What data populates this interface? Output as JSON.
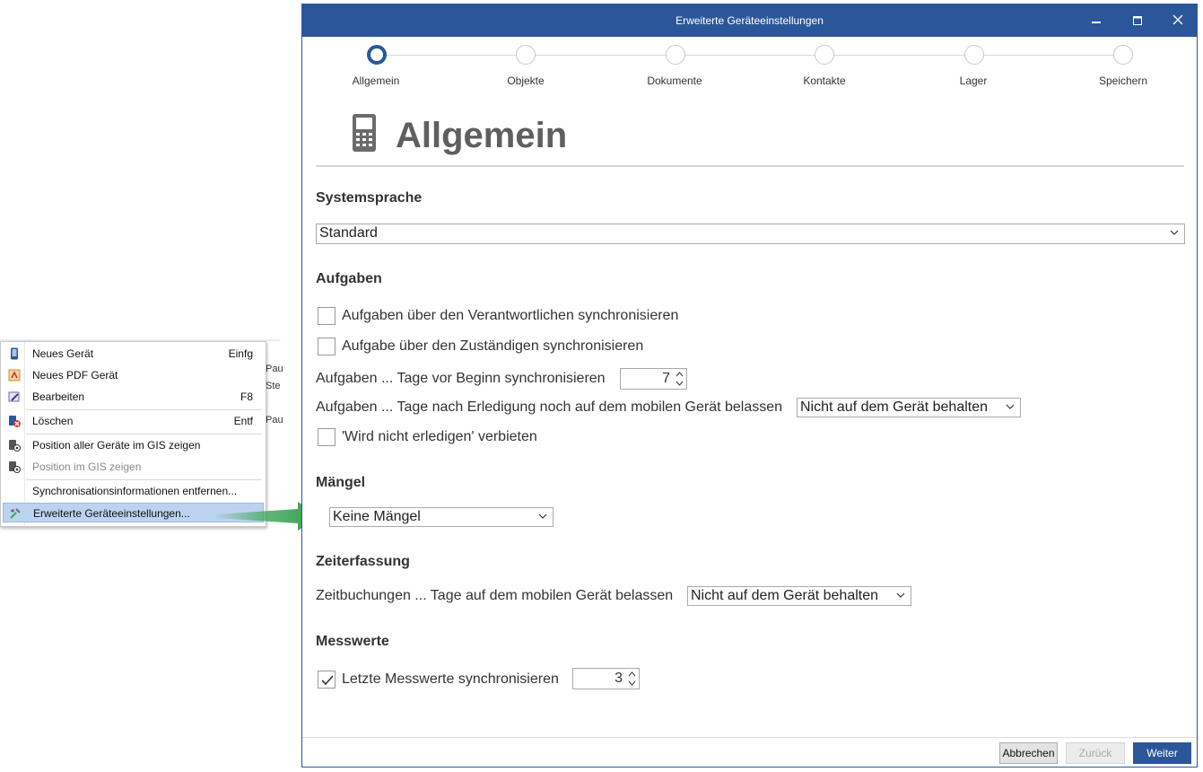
{
  "context_menu": {
    "items": [
      {
        "label": "Neues Gerät",
        "shortcut": "Einfg",
        "icon": "phone-icon"
      },
      {
        "label": "Neues PDF Gerät",
        "shortcut": "",
        "icon": "pdf-icon"
      },
      {
        "label": "Bearbeiten",
        "shortcut": "F8",
        "icon": "edit-icon"
      },
      {
        "label": "Löschen",
        "shortcut": "Entf",
        "icon": "delete-icon"
      },
      {
        "label": "Position aller Geräte im GIS zeigen",
        "shortcut": "",
        "icon": "gis-all-icon"
      },
      {
        "label": "Position im GIS zeigen",
        "shortcut": "",
        "icon": "gis-icon"
      },
      {
        "label": "Synchronisationsinformationen entfernen...",
        "shortcut": "",
        "icon": ""
      },
      {
        "label": "Erweiterte Geräteeinstellungen...",
        "shortcut": "",
        "icon": "tools-icon"
      }
    ]
  },
  "background_table": {
    "rows": [
      "Pau",
      "Ste",
      "Pau"
    ]
  },
  "dialog": {
    "title": "Erweiterte Geräteeinstellungen",
    "window_buttons": {
      "minimize": "▬",
      "maximize": "☐",
      "close": "✕"
    },
    "steps": [
      "Allgemein",
      "Objekte",
      "Dokumente",
      "Kontakte",
      "Lager",
      "Speichern"
    ],
    "active_step": 0,
    "page_title": "Allgemein",
    "systemsprache": {
      "heading": "Systemsprache",
      "value": "Standard"
    },
    "aufgaben": {
      "heading": "Aufgaben",
      "chk_verantwortlich": "Aufgaben über den Verantwortlichen synchronisieren",
      "chk_zustaendig": "Aufgabe über den Zuständigen synchronisieren",
      "tage_vor_label": "Aufgaben ... Tage vor Beginn synchronisieren",
      "tage_vor_value": "7",
      "tage_nach_label": "Aufgaben ... Tage nach Erledigung noch auf dem mobilen Gerät belassen",
      "tage_nach_value": "Nicht auf dem Gerät behalten",
      "chk_nicht_erledigen": "'Wird nicht erledigen' verbieten"
    },
    "maengel": {
      "heading": "Mängel",
      "value": "Keine Mängel"
    },
    "zeiterfassung": {
      "heading": "Zeiterfassung",
      "label": "Zeitbuchungen ... Tage auf dem mobilen Gerät belassen",
      "value": "Nicht auf dem Gerät behalten"
    },
    "messwerte": {
      "heading": "Messwerte",
      "chk_label": "Letzte Messwerte synchronisieren",
      "chk_checked": true,
      "value": "3"
    },
    "buttons": {
      "cancel": "Abbrechen",
      "back": "Zurück",
      "next": "Weiter"
    }
  },
  "colors": {
    "accent": "#2b579a",
    "arrow": "#3aa655",
    "menu_highlight": "#bcd3ef"
  }
}
